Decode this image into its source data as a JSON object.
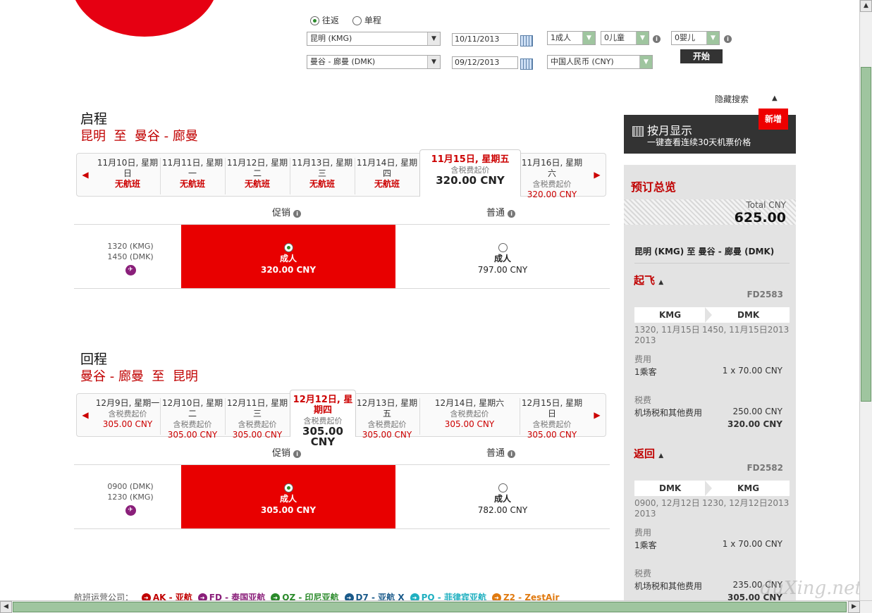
{
  "search": {
    "trip_round": "往返",
    "trip_oneway": "单程",
    "origin": "昆明 (KMG)",
    "destination": "曼谷 - 廊曼 (DMK)",
    "depart_date": "10/11/2013",
    "return_date": "09/12/2013",
    "adults": "1成人",
    "children": "0儿童",
    "infants": "0婴儿",
    "currency": "中国人民币 (CNY)",
    "submit": "开始",
    "hide": "隐藏搜索"
  },
  "outbound": {
    "title": "启程",
    "route": "昆明  至  曼谷 - 廊曼",
    "days": [
      {
        "date": "11月10日, 星期日",
        "status": "无航班"
      },
      {
        "date": "11月11日, 星期一",
        "status": "无航班"
      },
      {
        "date": "11月12日, 星期二",
        "status": "无航班"
      },
      {
        "date": "11月13日, 星期三",
        "status": "无航班"
      },
      {
        "date": "11月14日, 星期四",
        "status": "无航班"
      },
      {
        "date": "11月15日, 星期五",
        "sub": "含税费起价",
        "price": "320.00 CNY"
      },
      {
        "date": "11月16日, 星期六",
        "sub": "含税费起价",
        "price": "320.00 CNY"
      }
    ],
    "col_promo": "促销",
    "col_normal": "普通",
    "flight": {
      "dep": "1320  (KMG)",
      "arr": "1450  (DMK)",
      "promo_label": "成人",
      "promo_price": "320.00 CNY",
      "normal_label": "成人",
      "normal_price": "797.00 CNY"
    }
  },
  "inbound": {
    "title": "回程",
    "route": "曼谷 - 廊曼  至  昆明",
    "days": [
      {
        "date": "12月9日, 星期一",
        "sub": "含税费起价",
        "price": "305.00 CNY"
      },
      {
        "date": "12月10日, 星期二",
        "sub": "含税费起价",
        "price": "305.00 CNY"
      },
      {
        "date": "12月11日, 星期三",
        "sub": "含税费起价",
        "price": "305.00 CNY"
      },
      {
        "date": "12月12日, 星期四",
        "sub": "含税费起价",
        "price": "305.00 CNY"
      },
      {
        "date": "12月13日, 星期五",
        "sub": "含税费起价",
        "price": "305.00 CNY"
      },
      {
        "date": "12月14日, 星期六",
        "sub": "含税费起价",
        "price": "305.00 CNY"
      },
      {
        "date": "12月15日, 星期日",
        "sub": "含税费起价",
        "price": "305.00 CNY"
      }
    ],
    "col_promo": "促销",
    "col_normal": "普通",
    "flight": {
      "dep": "0900  (DMK)",
      "arr": "1230  (KMG)",
      "promo_label": "成人",
      "promo_price": "305.00 CNY",
      "normal_label": "成人",
      "normal_price": "782.00 CNY"
    }
  },
  "month_view": {
    "title": "按月显示",
    "subtitle": "一键查看连续30天机票价格",
    "badge": "新增"
  },
  "summary": {
    "title": "预订总览",
    "total_label": "Total CNY",
    "total": "625.00",
    "route": "昆明 (KMG) 至 曼谷 - 廊曼 (DMK)",
    "depart": {
      "label": "起飞",
      "flight_no": "FD2583",
      "from": "KMG",
      "to": "DMK",
      "from_time": "1320, 11月15日 2013",
      "to_time": "1450, 11月15日2013",
      "fee_label": "费用",
      "pax": "1乘客",
      "pax_fee": "1 x 70.00 CNY",
      "tax_label": "税费",
      "tax_desc": "机场税和其他费用",
      "tax": "250.00 CNY",
      "subtotal": "320.00 CNY"
    },
    "return": {
      "label": "返回",
      "flight_no": "FD2582",
      "from": "DMK",
      "to": "KMG",
      "from_time": "0900, 12月12日 2013",
      "to_time": "1230, 12月12日2013",
      "fee_label": "费用",
      "pax": "1乘客",
      "pax_fee": "1 x 70.00 CNY",
      "tax_label": "税费",
      "tax_desc": "机场税和其他费用",
      "tax": "235.00 CNY",
      "subtotal": "305.00 CNY"
    }
  },
  "operators": {
    "label": "航班运营公司：",
    "items": [
      {
        "code": "AK",
        "name": "AK - 亚航",
        "color": "#c00000"
      },
      {
        "code": "FD",
        "name": "FD - 泰国亚航",
        "color": "#8a1f7a"
      },
      {
        "code": "QZ",
        "name": "QZ - 印尼亚航",
        "color": "#2a8a2a"
      },
      {
        "code": "D7",
        "name": "D7 - 亚航 X",
        "color": "#1a5a8a"
      },
      {
        "code": "PQ",
        "name": "PQ - 菲律宾亚航",
        "color": "#20b0c0"
      },
      {
        "code": "Z2",
        "name": "Z2 - ZestAir",
        "color": "#e07a10"
      }
    ]
  },
  "watermark": "duXing.net"
}
